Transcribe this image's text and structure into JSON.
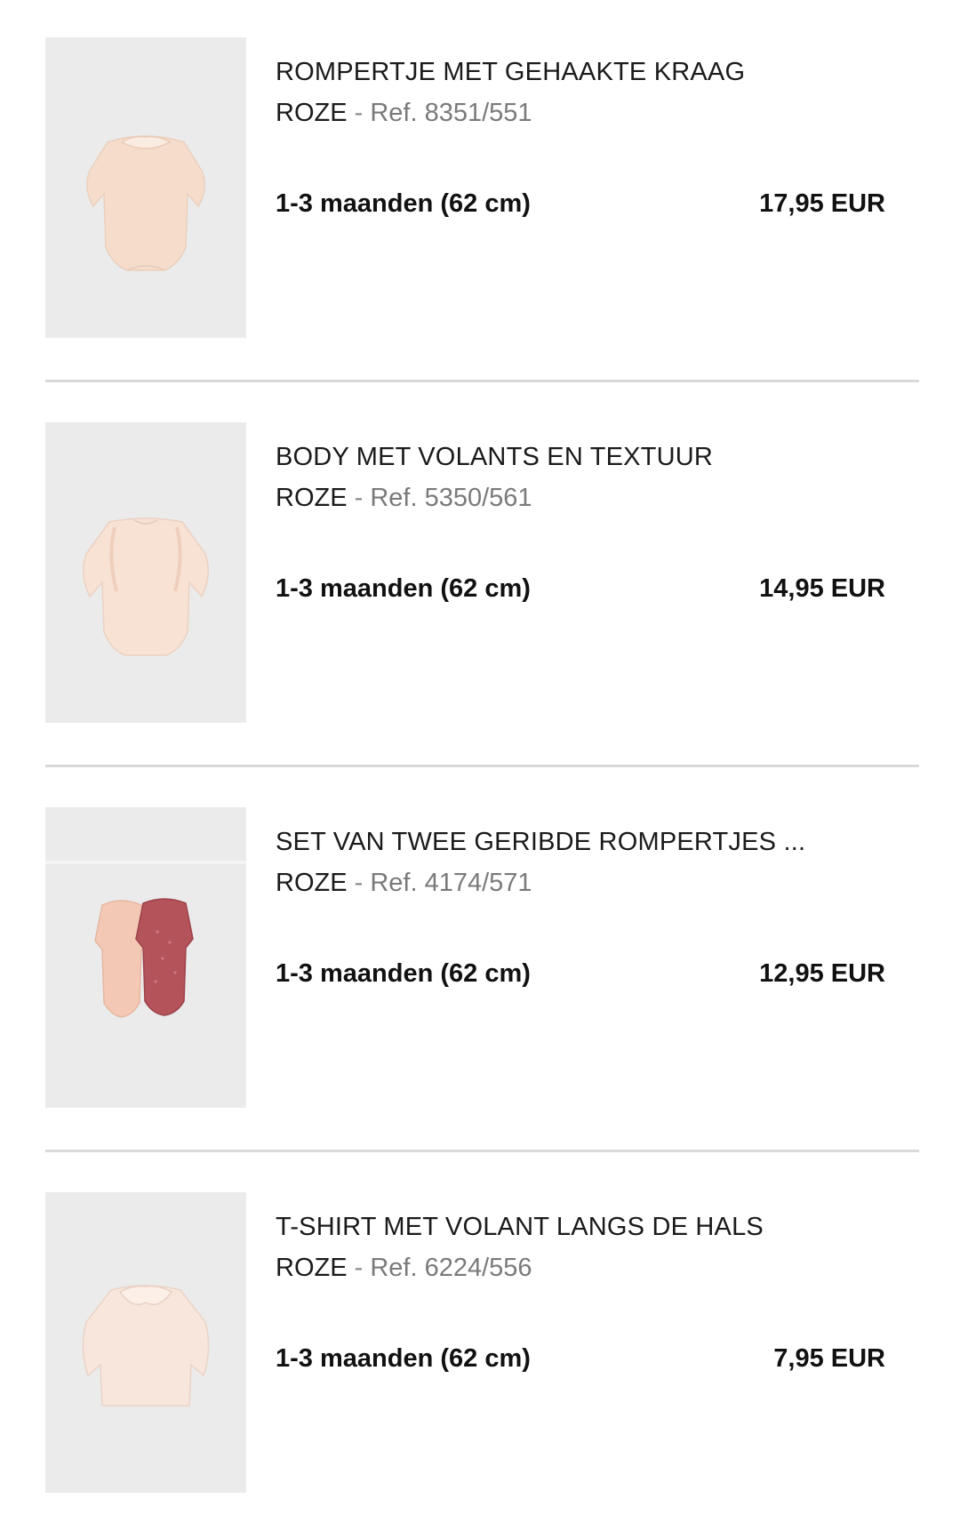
{
  "items": [
    {
      "title": "ROMPERTJE MET GEHAAKTE KRAAG",
      "color": "ROZE",
      "separator": "-",
      "ref": "Ref. 8351/551",
      "size": "1-3 maanden (62 cm)",
      "price": "17,95 EUR"
    },
    {
      "title": "BODY MET VOLANTS EN TEXTUUR",
      "color": "ROZE",
      "separator": "-",
      "ref": "Ref. 5350/561",
      "size": "1-3 maanden (62 cm)",
      "price": "14,95 EUR"
    },
    {
      "title": "SET VAN TWEE GERIBDE ROMPERTJES ...",
      "color": "ROZE",
      "separator": "-",
      "ref": "Ref. 4174/571",
      "size": "1-3 maanden (62 cm)",
      "price": "12,95 EUR"
    },
    {
      "title": "T-SHIRT MET VOLANT LANGS DE HALS",
      "color": "ROZE",
      "separator": "-",
      "ref": "Ref. 6224/556",
      "size": "1-3 maanden (62 cm)",
      "price": "7,95 EUR"
    }
  ],
  "colors": {
    "thumbnail_bg": "#ebebeb",
    "divider": "#d9d9d9",
    "garment_light_pink": "#f6dccb",
    "garment_dark_rose": "#b5535a",
    "ref_text": "#7a7a7a"
  }
}
